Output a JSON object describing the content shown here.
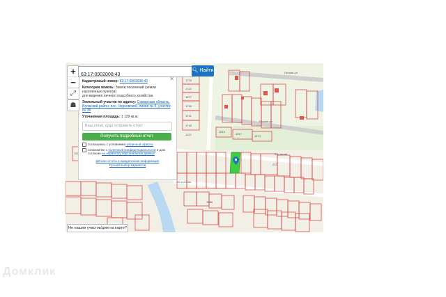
{
  "search": {
    "value": "63:17:0902008:43",
    "button_label": "Найти"
  },
  "zoom": {
    "in": "+",
    "out": "−"
  },
  "panel": {
    "cadastral_label": "Кадастровый номер:",
    "cadastral_value": "63:17:0902008:43",
    "category_label": "Категория земель:",
    "category_value": "Земли поселений (земли населенных пунктов)",
    "use_value": "для ведения личного подсобного хозяйства",
    "address_label": "Земельный участок по адресу:",
    "address_value": "Самарская область, Волжский район, пос. Черновский, линия № 5, участок № 36",
    "area_label": "Уточненная площадь:",
    "area_value": "1 129 кв.м.",
    "email_placeholder": "Ваш email, куда отправить отчет",
    "report_button": "Получить подробный отчет",
    "consent1_text": "соглашаюсь с условиями",
    "consent1_link": "публичной оферты",
    "consent2_text": "ознакомлен с",
    "consent2_link1": "политикой конфиденциальности",
    "consent2_mid": "и даю согласие",
    "consent2_link2": "на обработку персональных данных",
    "link_details": "Детали отчета и юридическая информация",
    "link_manual": "Ручной выбор вариантов"
  },
  "bottom_button": "Не нашли участок/дом на карте?",
  "map_labels": {
    "street1": "Лесная ул.",
    "street2": "Лесная ул.",
    "street3": "9-я линия",
    "street4": "10-я линия",
    "parcels": [
      "1723",
      "1722",
      "1577",
      "1745",
      "1741",
      "1743",
      "1122",
      "1517",
      "1516",
      "1515",
      "1514",
      "1574",
      "1592",
      "1585",
      "1584",
      "1583",
      "237",
      "1108",
      "1588"
    ]
  },
  "watermark": "Домклик",
  "colors": {
    "accent": "#1e73be",
    "green": "#4cae4c",
    "parcel_line": "#d43a3a",
    "highlight": "#3fcf3f"
  }
}
